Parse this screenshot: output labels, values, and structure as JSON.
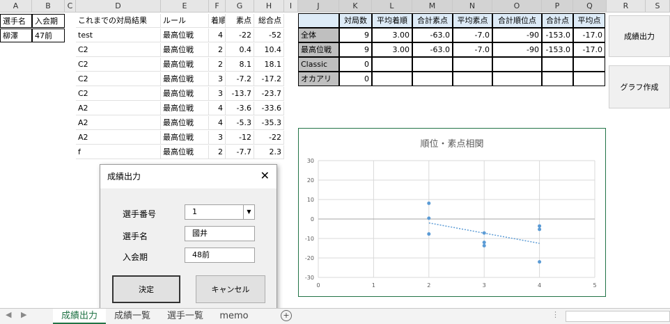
{
  "columns": [
    "A",
    "B",
    "C",
    "D",
    "E",
    "F",
    "G",
    "H",
    "I",
    "J",
    "K",
    "L",
    "M",
    "N",
    "O",
    "P",
    "Q",
    "R",
    "S"
  ],
  "player_table": {
    "headers": [
      "選手名",
      "入会期"
    ],
    "values": [
      "柳澤",
      "47前"
    ]
  },
  "results_table": {
    "headers": [
      "これまでの対局結果",
      "ルール",
      "着順",
      "素点",
      "総合点"
    ],
    "rows": [
      [
        "test",
        "最高位戦",
        "4",
        "-22",
        "-52"
      ],
      [
        "C2",
        "最高位戦",
        "2",
        "0.4",
        "10.4"
      ],
      [
        "C2",
        "最高位戦",
        "2",
        "8.1",
        "18.1"
      ],
      [
        "C2",
        "最高位戦",
        "3",
        "-7.2",
        "-17.2"
      ],
      [
        "C2",
        "最高位戦",
        "3",
        "-13.7",
        "-23.7"
      ],
      [
        "A2",
        "最高位戦",
        "4",
        "-3.6",
        "-33.6"
      ],
      [
        "A2",
        "最高位戦",
        "4",
        "-5.3",
        "-35.3"
      ],
      [
        "A2",
        "最高位戦",
        "3",
        "-12",
        "-22"
      ],
      [
        "f",
        "最高位戦",
        "2",
        "-7.7",
        "2.3"
      ]
    ]
  },
  "summary_table": {
    "headers": [
      "",
      "対局数",
      "平均着順",
      "合計素点",
      "平均素点",
      "合計順位点",
      "合計点",
      "平均点"
    ],
    "rows": [
      [
        "全体",
        "9",
        "3.00",
        "-63.0",
        "-7.0",
        "-90",
        "-153.0",
        "-17.0"
      ],
      [
        "最高位戦",
        "9",
        "3.00",
        "-63.0",
        "-7.0",
        "-90",
        "-153.0",
        "-17.0"
      ],
      [
        "Classic",
        "0",
        "",
        "",
        "",
        "",
        "",
        ""
      ],
      [
        "オカアリ",
        "0",
        "",
        "",
        "",
        "",
        "",
        ""
      ]
    ]
  },
  "side_buttons": {
    "output": "成績出力",
    "graph": "グラフ作成"
  },
  "chart_data": {
    "type": "scatter",
    "title": "順位・素点相関",
    "xlim": [
      0,
      5
    ],
    "ylim": [
      -30,
      30
    ],
    "x_ticks": [
      0,
      1,
      2,
      3,
      4,
      5
    ],
    "y_ticks": [
      30,
      20,
      10,
      0,
      -10,
      -20,
      -30
    ],
    "points": [
      [
        2,
        8.1
      ],
      [
        2,
        0.4
      ],
      [
        2,
        -7.7
      ],
      [
        3,
        -7.2
      ],
      [
        3,
        -12
      ],
      [
        3,
        -13.7
      ],
      [
        4,
        -3.6
      ],
      [
        4,
        -5.3
      ],
      [
        4,
        -22
      ]
    ],
    "trendline": {
      "x": [
        2,
        4
      ],
      "y": [
        -2,
        -12.5
      ]
    },
    "colors": {
      "points": "#5b9bd5",
      "grid": "#d9d9d9"
    }
  },
  "dialog": {
    "title": "成績出力",
    "fields": [
      {
        "label": "選手番号",
        "value": "1"
      },
      {
        "label": "選手名",
        "value": "國井"
      },
      {
        "label": "入会期",
        "value": "48前"
      }
    ],
    "ok": "決定",
    "cancel": "キャンセル"
  },
  "sheet_tabs": [
    "成績出力",
    "成績一覧",
    "選手一覧",
    "memo"
  ]
}
